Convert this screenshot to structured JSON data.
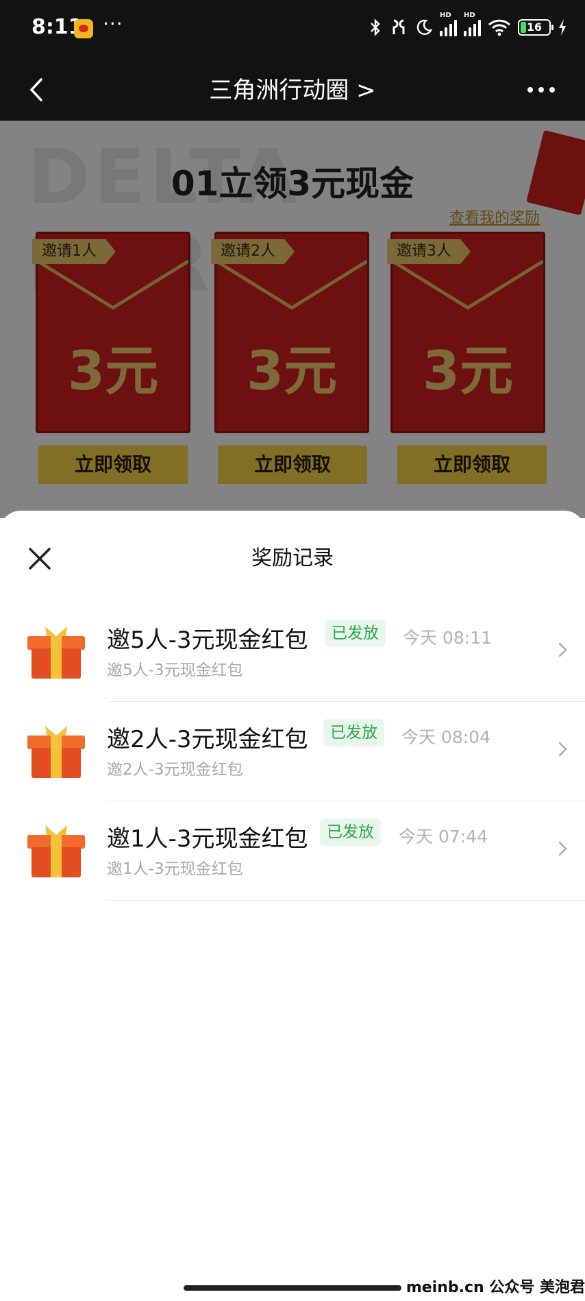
{
  "status_bar": {
    "time": "8:11",
    "dots": "···",
    "battery": "16"
  },
  "nav": {
    "title": "三角洲行动圈 >"
  },
  "background": {
    "watermark": "DELTA FORCE",
    "title": "01立领3元现金",
    "link": "查看我的奖励",
    "cards": [
      {
        "tag": "邀请1人",
        "amount": "3元",
        "button": "立即领取"
      },
      {
        "tag": "邀请2人",
        "amount": "3元",
        "button": "立即领取"
      },
      {
        "tag": "邀请3人",
        "amount": "3元",
        "button": "立即领取"
      }
    ]
  },
  "sheet": {
    "title": "奖励记录",
    "records": [
      {
        "name": "邀5人-3元现金红包",
        "status": "已发放",
        "time": "今天 08:11",
        "desc": "邀5人-3元现金红包"
      },
      {
        "name": "邀2人-3元现金红包",
        "status": "已发放",
        "time": "今天 08:04",
        "desc": "邀2人-3元现金红包"
      },
      {
        "name": "邀1人-3元现金红包",
        "status": "已发放",
        "time": "今天 07:44",
        "desc": "邀1人-3元现金红包"
      }
    ]
  },
  "footer": {
    "watermark": "meinb.cn  公众号 美泡君"
  },
  "colors": {
    "status_green": "#2fa84f",
    "status_green_bg": "#e9f6ec",
    "envelope_red": "#c8201c",
    "gold": "#f1cd47"
  }
}
